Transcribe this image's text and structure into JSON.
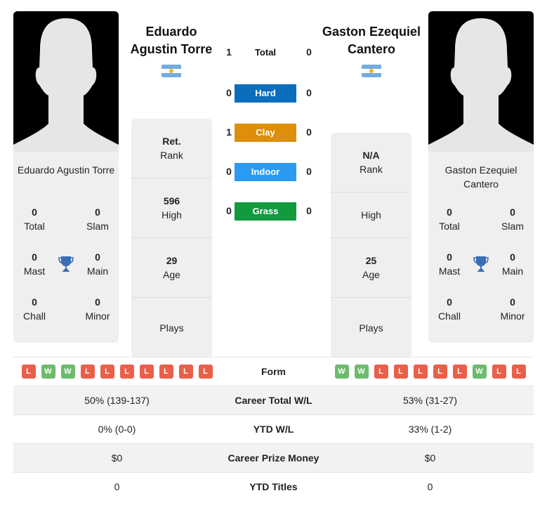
{
  "players": [
    {
      "name": "Eduardo Agustin Torre",
      "title_line1": "Eduardo",
      "title_line2": "Agustin Torre",
      "card_name": "Eduardo Agustin Torre",
      "country_flag": "argentina-flag",
      "titles": {
        "total": "0",
        "slam": "0",
        "mast": "0",
        "main": "0",
        "chall": "0",
        "minor": "0"
      },
      "stats": {
        "rank_value": "Ret.",
        "rank_label": "Rank",
        "high_value": "596",
        "high_label": "High",
        "age_value": "29",
        "age_label": "Age",
        "plays_value": "",
        "plays_label": "Plays"
      },
      "form": [
        "L",
        "W",
        "W",
        "L",
        "L",
        "L",
        "L",
        "L",
        "L",
        "L"
      ]
    },
    {
      "name": "Gaston Ezequiel Cantero",
      "title_line1": "Gaston Ezequiel",
      "title_line2": "Cantero",
      "card_name_line1": "Gaston Ezequiel",
      "card_name_line2": "Cantero",
      "country_flag": "argentina-flag",
      "titles": {
        "total": "0",
        "slam": "0",
        "mast": "0",
        "main": "0",
        "chall": "0",
        "minor": "0"
      },
      "stats": {
        "rank_value": "N/A",
        "rank_label": "Rank",
        "high_value": "",
        "high_label": "High",
        "age_value": "25",
        "age_label": "Age",
        "plays_value": "",
        "plays_label": "Plays"
      },
      "form": [
        "W",
        "W",
        "L",
        "L",
        "L",
        "L",
        "L",
        "W",
        "L",
        "L"
      ]
    }
  ],
  "title_labels": {
    "total": "Total",
    "slam": "Slam",
    "mast": "Mast",
    "main": "Main",
    "chall": "Chall",
    "minor": "Minor"
  },
  "h2h": [
    {
      "label": "Total",
      "left": "1",
      "right": "0",
      "color": ""
    },
    {
      "label": "Hard",
      "left": "0",
      "right": "0",
      "color": "#0a6ebd"
    },
    {
      "label": "Clay",
      "left": "1",
      "right": "0",
      "color": "#de8e0a"
    },
    {
      "label": "Indoor",
      "left": "0",
      "right": "0",
      "color": "#2b9af3"
    },
    {
      "label": "Grass",
      "left": "0",
      "right": "0",
      "color": "#129a3f"
    }
  ],
  "comparison": {
    "form_label": "Form",
    "rows": [
      {
        "label": "Career Total W/L",
        "left": "50% (139-137)",
        "right": "53% (31-27)"
      },
      {
        "label": "YTD W/L",
        "left": "0% (0-0)",
        "right": "33% (1-2)"
      },
      {
        "label": "Career Prize Money",
        "left": "$0",
        "right": "$0"
      },
      {
        "label": "YTD Titles",
        "left": "0",
        "right": "0"
      }
    ]
  }
}
